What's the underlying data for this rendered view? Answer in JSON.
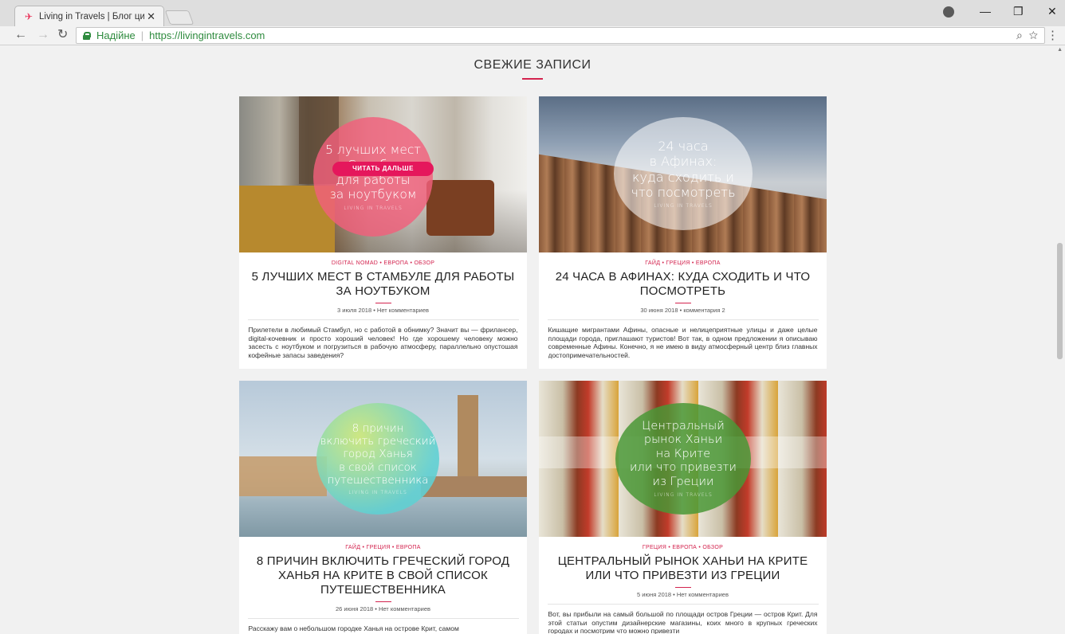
{
  "browser": {
    "tab_title": "Living in Travels | Блог цифрового",
    "tab_close": "✕",
    "secure_label": "Надійне",
    "url": "https://livingintravels.com",
    "minimize": "—",
    "restore": "❐",
    "close": "✕"
  },
  "section": {
    "title": "СВЕЖИЕ ЗАПИСИ"
  },
  "colors": {
    "accent": "#d3234e",
    "secure": "#2e8b3e"
  },
  "cards": [
    {
      "circle_text": "5 лучших мест\nв Стамбуле\nдля работы\nза ноутбуком",
      "circle_logo": "LIVING IN TRAVELS",
      "read_more": "ЧИТАТЬ ДАЛЬШЕ",
      "categories": "DIGITAL NOMAD  •  ЕВРОПА  •  ОБЗОР",
      "title": "5 ЛУЧШИХ МЕСТ В СТАМБУЛЕ ДЛЯ РАБОТЫ ЗА НОУТБУКОМ",
      "meta": "3 июля 2018  •  Нет комментариев",
      "excerpt": "Прилетели в любимый Стамбул, но с работой в обнимку? Значит вы — фрилансер, digital-кочевник и просто хороший человек! Но где хорошему человеку можно засесть с ноутбуком и погрузиться в рабочую атмосферу, параллельно опустошая кофейные запасы заведения?"
    },
    {
      "circle_text": "24 часа\nв Афинах:\nкуда сходить и\nчто посмотреть",
      "circle_logo": "LIVING IN TRAVELS",
      "categories": "ГАЙД  •  ГРЕЦИЯ  •  ЕВРОПА",
      "title": "24 ЧАСА В АФИНАХ: КУДА СХОДИТЬ И ЧТО ПОСМОТРЕТЬ",
      "meta": "30 июня 2018  •  комментария 2",
      "excerpt": "Кишащие мигрантами Афины, опасные и нелицеприятные улицы и даже целые площади города, приглашают туристов! Вот так, в одном предложении я описываю современные Афины. Конечно, я не имею в виду атмосферный центр близ главных достопримечательностей."
    },
    {
      "circle_text": "8 причин\nвключить греческий\nгород Ханья\nв свой список\nпутешественника",
      "circle_logo": "LIVING IN TRAVELS",
      "categories": "ГАЙД  •  ГРЕЦИЯ  •  ЕВРОПА",
      "title": "8 ПРИЧИН ВКЛЮЧИТЬ ГРЕЧЕСКИЙ ГОРОД ХАНЬЯ НА КРИТЕ В СВОЙ СПИСОК ПУТЕШЕСТВЕННИКА",
      "meta": "26 июня 2018  •  Нет комментариев",
      "excerpt": "Расскажу вам о небольшом городке Ханья на острове Крит, самом"
    },
    {
      "circle_text": "Центральный\nрынок Ханьи\nна Крите\nили что привезти\nиз Греции",
      "circle_logo": "LIVING IN TRAVELS",
      "categories": "ГРЕЦИЯ  •  ЕВРОПА  •  ОБЗОР",
      "title": "ЦЕНТРАЛЬНЫЙ РЫНОК ХАНЬИ НА КРИТЕ ИЛИ ЧТО ПРИВЕЗТИ ИЗ ГРЕЦИИ",
      "meta": "5 июня 2018  •  Нет комментариев",
      "excerpt": "Вот, вы прибыли на самый большой по площади остров Греции — остров Крит. Для этой статьи опустим дизайнерские магазины, коих много в крупных греческих городах и посмотрим что можно привезти"
    }
  ]
}
